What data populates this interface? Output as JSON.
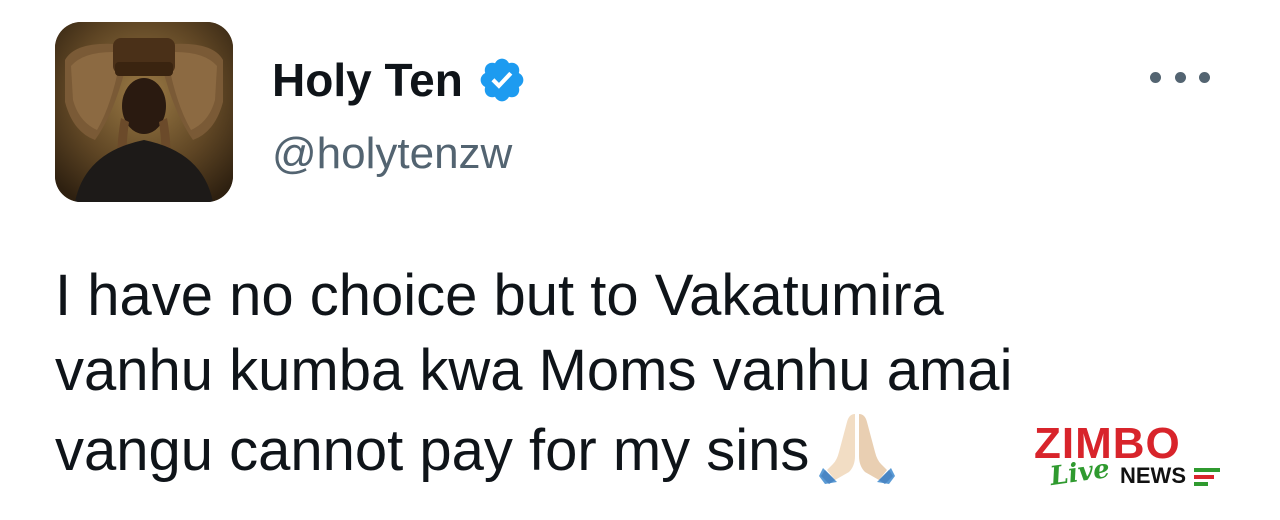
{
  "tweet": {
    "display_name": "Holy Ten",
    "handle": "@holytenzw",
    "verified": true,
    "verified_icon": "verified-badge-icon",
    "more_icon": "more-options-icon",
    "text": "I have no choice but to Vakatumira\nvanhu kumba kwa Moms vanhu amai\nvangu cannot pay for my sins",
    "emoji": "folded-hands-emoji"
  },
  "watermark": {
    "brand": "ZIMBO",
    "live": "Live",
    "news": "NEWS"
  },
  "colors": {
    "text_primary": "#0f1419",
    "text_secondary": "#536471",
    "verified_blue": "#1d9bf0",
    "watermark_red": "#d8242b",
    "watermark_green": "#2f9a2f"
  }
}
